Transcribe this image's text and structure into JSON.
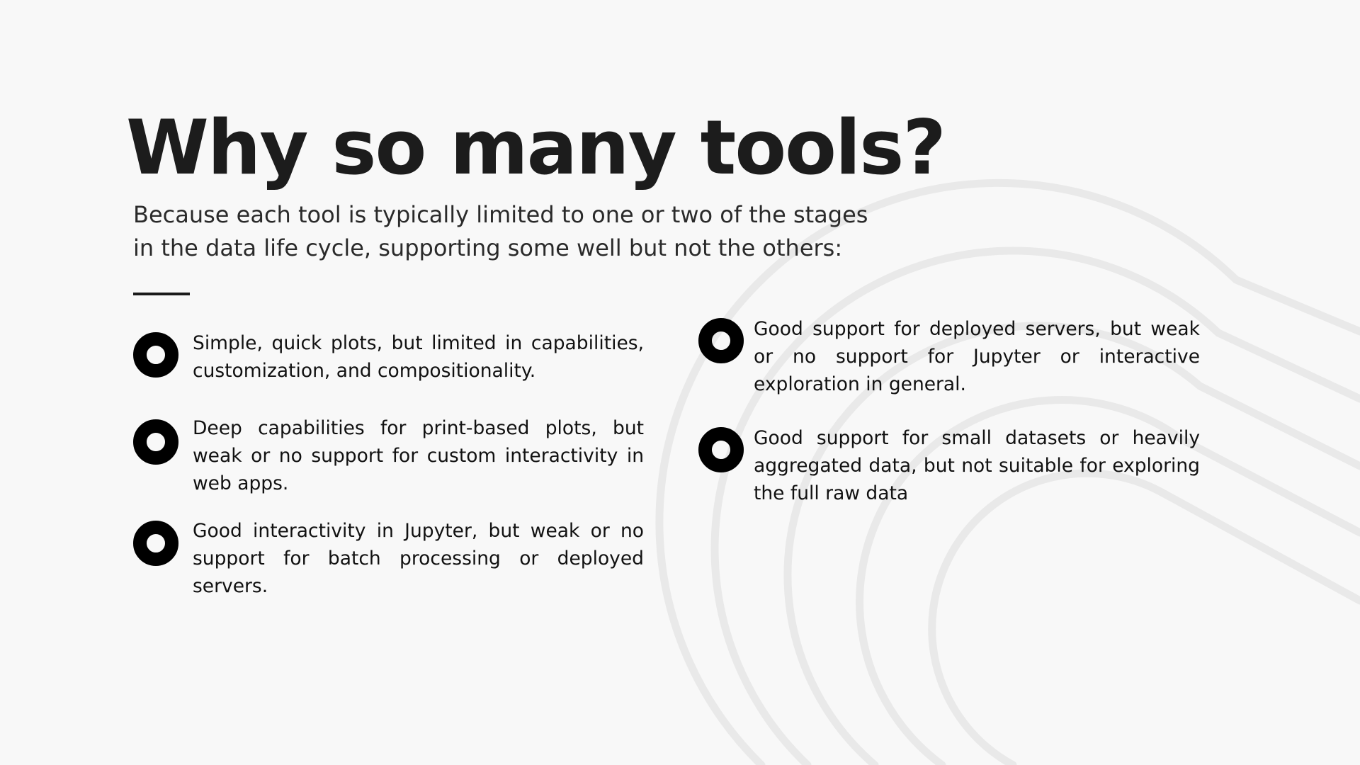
{
  "slide": {
    "title": "Why so many tools?",
    "subtitle": "Because each tool is typically limited to one or two of the stages in the data life cycle, supporting some well but not the others:"
  },
  "items": [
    {
      "text": "Simple, quick plots, but limited in capabilities, customization, and compositionality."
    },
    {
      "text": "Deep capabilities for print-based plots, but weak or no support for custom interactivity in web apps."
    },
    {
      "text": "Good interactivity in Jupyter, but weak or no support for batch processing or deployed servers."
    },
    {
      "text": "Good support for deployed servers, but weak or no support for Jupyter or interactive exploration in general."
    },
    {
      "text": "Good support for small datasets or heavily aggregated data, but not suitable for exploring the full raw data"
    }
  ],
  "colors": {
    "background": "#f8f8f8",
    "title": "#1c1c1c",
    "bullet_ring": "#000000",
    "decorative_arcs": "#e8e8e8"
  },
  "icons": {
    "bullet": "ring-bullet-icon"
  }
}
